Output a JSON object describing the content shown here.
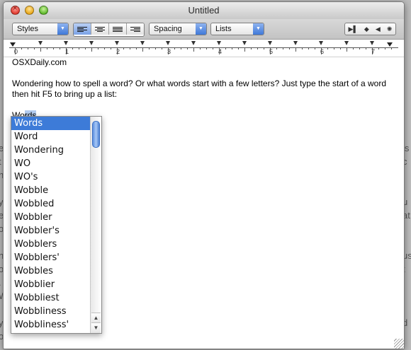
{
  "window": {
    "title": "Untitled"
  },
  "toolbar": {
    "styles_label": "Styles",
    "spacing_label": "Spacing",
    "lists_label": "Lists",
    "alignment": [
      "align-left",
      "align-center",
      "justify",
      "align-right"
    ],
    "active_alignment": "align-left"
  },
  "ruler": {
    "numbers": [
      "0",
      "1",
      "2",
      "3",
      "4",
      "5",
      "6",
      "7"
    ]
  },
  "document": {
    "line1": "OSXDaily.com",
    "line2": "Wondering how to spell a word? Or what words start with a few letters? Just type the start of a word then hit F5 to bring up a list:",
    "typed_prefix": "Wo",
    "typed_selected": "rds"
  },
  "completions": {
    "selected": "Words",
    "items": [
      "Words",
      "Word",
      "Wondering",
      "WO",
      "WO's",
      "Wobble",
      "Wobbled",
      "Wobbler",
      "Wobbler's",
      "Wobblers",
      "Wobblers'",
      "Wobbles",
      "Wobblier",
      "Wobbliest",
      "Wobbliness",
      "Wobbliness'"
    ]
  },
  "colors": {
    "selection": "#3d7bd8",
    "text_highlight": "#b3ccef"
  },
  "icons": {
    "nav": [
      "first-icon",
      "diamond-icon",
      "prev-icon",
      "settings-icon"
    ]
  }
}
